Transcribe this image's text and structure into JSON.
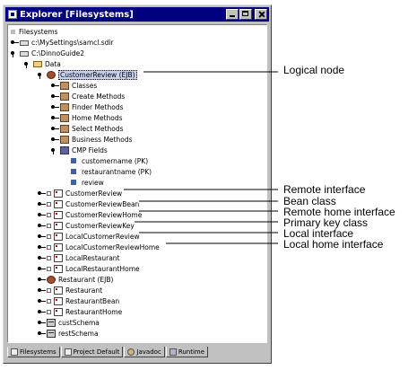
{
  "window": {
    "title": "Explorer [Filesystems]"
  },
  "tree": {
    "root": "Filesystems",
    "items": [
      {
        "label": "c:\\MySettings\\samcl.sdir"
      },
      {
        "label": "C:\\DinnoGuide2"
      },
      {
        "label": "Data"
      },
      {
        "label": "CustomerReview (EJB)"
      },
      {
        "label": "Classes"
      },
      {
        "label": "Create Methods"
      },
      {
        "label": "Finder Methods"
      },
      {
        "label": "Home Methods"
      },
      {
        "label": "Select Methods"
      },
      {
        "label": "Business Methods"
      },
      {
        "label": "CMP Fields"
      },
      {
        "label": "customername (PK)"
      },
      {
        "label": "restaurantname (PK)"
      },
      {
        "label": "review"
      },
      {
        "label": "CustomerReview"
      },
      {
        "label": "CustomerReviewBean"
      },
      {
        "label": "CustomerReviewHome"
      },
      {
        "label": "CustomerReviewKey"
      },
      {
        "label": "LocalCustomerReview"
      },
      {
        "label": "LocalCustomerReviewHome"
      },
      {
        "label": "LocalRestaurant"
      },
      {
        "label": "LocalRestaurantHome"
      },
      {
        "label": "Restaurant (EJB)"
      },
      {
        "label": "Restaurant"
      },
      {
        "label": "RestaurantBean"
      },
      {
        "label": "RestaurantHome"
      },
      {
        "label": "custSchema"
      },
      {
        "label": "restSchema"
      }
    ]
  },
  "tabs": [
    {
      "label": "Filesystems"
    },
    {
      "label": "Project Default"
    },
    {
      "label": "Javadoc"
    },
    {
      "label": "Runtime"
    }
  ],
  "callouts": {
    "logical_node": "Logical node",
    "remote_interface": "Remote interface",
    "bean_class": "Bean class",
    "remote_home_interface": "Remote home interface",
    "primary_key_class": "Primary key class",
    "local_interface": "Local interface",
    "local_home_interface": "Local home interface"
  }
}
